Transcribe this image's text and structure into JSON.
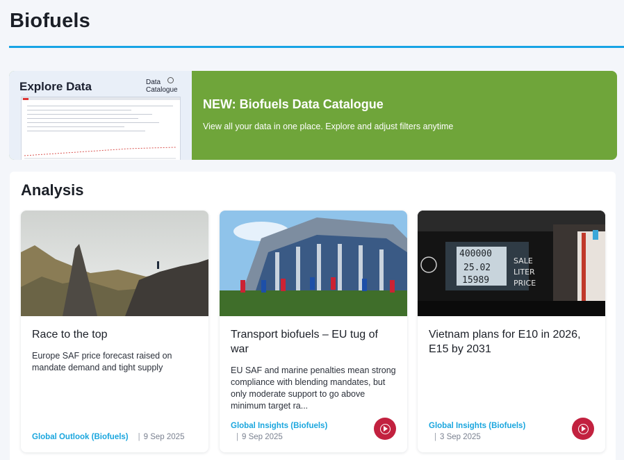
{
  "page": {
    "title": "Biofuels"
  },
  "banner": {
    "thumb_title": "Explore Data",
    "thumb_logo": "Data Catalogue",
    "heading": "NEW: Biofuels Data Catalogue",
    "subtext": "View all your data in one place. Explore and adjust filters anytime"
  },
  "analysis": {
    "title": "Analysis",
    "cards": [
      {
        "title": "Race to the top",
        "description": "Europe SAF price forecast raised on mandate demand and tight supply",
        "source": "Global Outlook (Biofuels)",
        "separator": "|",
        "date": "9 Sep 2025",
        "has_play": false
      },
      {
        "title": "Transport biofuels – EU tug of war",
        "description": "EU SAF and marine penalties mean strong compliance with blending mandates, but only moderate support to go above minimum target ra...",
        "source": "Global Insights (Biofuels)",
        "separator": "|",
        "date": "9 Sep 2025",
        "has_play": true
      },
      {
        "title": "Vietnam plans for E10 in 2026, E15 by 2031",
        "description": "",
        "source": "Global Insights (Biofuels)",
        "separator": "|",
        "date": "3 Sep 2025",
        "has_play": true
      }
    ],
    "fuel_display": {
      "numbers": [
        "400000",
        "25.02",
        "15989"
      ],
      "labels": [
        "SALE",
        "LITER",
        "PRICE"
      ]
    }
  },
  "colors": {
    "accent": "#17a4e5",
    "banner_green": "#6fa53a",
    "play_red": "#c2213f",
    "source_blue": "#1aa6de"
  },
  "icons": [
    "magnifier-icon",
    "play-circle-icon"
  ]
}
